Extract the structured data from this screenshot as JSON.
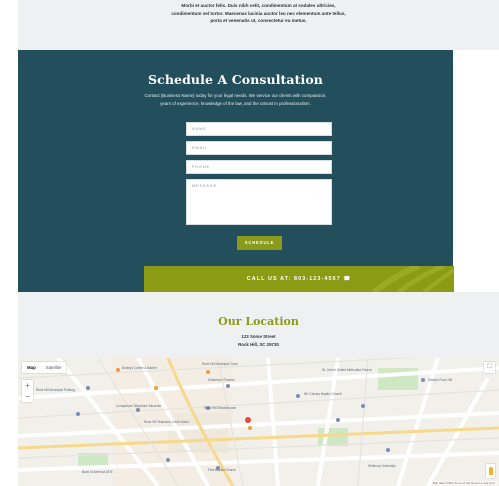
{
  "intro": {
    "lines": [
      "Morbi et auctor felis. Duis nibh velit, condimentum at sodales ultricies,",
      "condimentum vel tortor. Maecenas lacinia auctor leo nec elementum ante tellus,",
      "porta et venenatis ut, consectetur eu metus."
    ]
  },
  "consultation": {
    "title": "Schedule A Consultation",
    "description_lines": [
      "Contact {Business Name} today for your legal needs. We service our clients with compassion,",
      "years of experience, knowledge of the law, and the utmost in professionalism."
    ],
    "form": {
      "name_placeholder": "NAME",
      "email_placeholder": "EMAIL",
      "phone_placeholder": "PHONE",
      "message_placeholder": "MESSAGE",
      "submit_label": "SCHEDULE"
    },
    "call_bar": "CALL US AT: 803-123-4567 ☎"
  },
  "location": {
    "title": "Our Location",
    "street": "123 Some Street",
    "city": "Rock Hill, SC 29730"
  },
  "map": {
    "type_options": [
      "Map",
      "Satellite"
    ],
    "selected_type": "Map",
    "zoom_in": "+",
    "zoom_out": "−",
    "fullscreen_icon": "⛶",
    "attribution": "Map data ©2024   Terms of Use   Report a map error",
    "labels": [
      "Rock Hill Municipal Parking",
      "Bobby's Coffee & Barber",
      "Rock Hill Municipal Court",
      "Kimberly's Flowers",
      "Mt. Calvary Baptist Church",
      "Comporium Telephone Museum",
      "Rock Hill Teachers Credit Union",
      "Rock Hill Smokehouse",
      "St. John's United Methodist Church",
      "Historic Rock Hill",
      "First Baptist Church",
      "Bank of America ATM",
      "Winthrop University"
    ],
    "colors": {
      "background": "#f2f0eb",
      "major_road": "#ffffff",
      "highlight_road": "#f7d98a",
      "park": "#cfe8c4",
      "poi_pin": "#7a8fb5",
      "food_pin": "#f39a3c"
    }
  },
  "colors": {
    "primary_teal": "#234f5d",
    "accent_olive": "#8b9b14",
    "light_gray": "#eef0f2"
  }
}
